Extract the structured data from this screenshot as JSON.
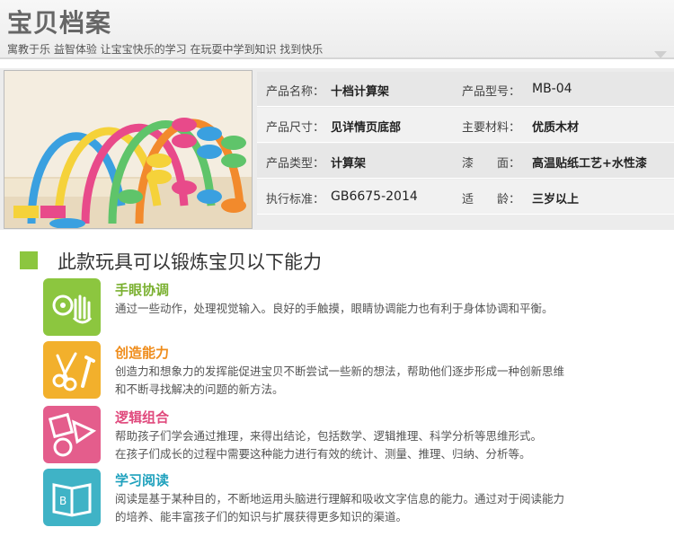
{
  "header": {
    "title": "宝贝档案",
    "subtitle": "寓教于乐 益智体验 让宝宝快乐的学习 在玩耍中学到知识 找到快乐"
  },
  "specs": [
    {
      "label_left": "产品名称：",
      "value_left": "十档计算架",
      "label_right": "产品型号：",
      "value_right": "MB-04"
    },
    {
      "label_left": "产品尺寸：",
      "value_left": "见详情页底部",
      "label_right": "主要材料：",
      "value_right": "优质木材"
    },
    {
      "label_left": "产品类型：",
      "value_left": "计算架",
      "label_right": "漆　　面：",
      "value_right": "高温贴纸工艺+水性漆"
    },
    {
      "label_left": "执行标准：",
      "value_left": "GB6675-2014",
      "label_right": "适　　龄：",
      "value_right": "三岁以上"
    }
  ],
  "abilities_section": {
    "title": "此款玩具可以锻炼宝贝以下能力",
    "items": [
      {
        "title": "手眼协调",
        "icon": "hand-eye-icon",
        "color": "#8cc63f",
        "lines": [
          "通过一些动作，处理视觉输入。良好的手触摸，眼睛协调能力也有利于身体协调和平衡。"
        ]
      },
      {
        "title": "创造能力",
        "icon": "tools-icon",
        "color": "#f2b02c",
        "lines": [
          "创造力和想象力的发挥能促进宝贝不断尝试一些新的想法，帮助他们逐步形成一种创新思维",
          "和不断寻找解决的问题的新方法。"
        ]
      },
      {
        "title": "逻辑组合",
        "icon": "shapes-icon",
        "color": "#e45d8c",
        "lines": [
          "帮助孩子们学会通过推理，来得出结论，包括数学、逻辑推理、科学分析等思维形式。",
          "在孩子们成长的过程中需要这种能力进行有效的统计、测量、推理、归纳、分析等。"
        ]
      },
      {
        "title": "学习阅读",
        "icon": "book-icon",
        "color": "#3fb3c6",
        "lines": [
          "阅读是基于某种目的，不断地运用头脑进行理解和吸收文字信息的能力。通过对于阅读能力",
          "的培养、能丰富孩子们的知识与扩展获得更多知识的渠道。"
        ]
      }
    ]
  }
}
